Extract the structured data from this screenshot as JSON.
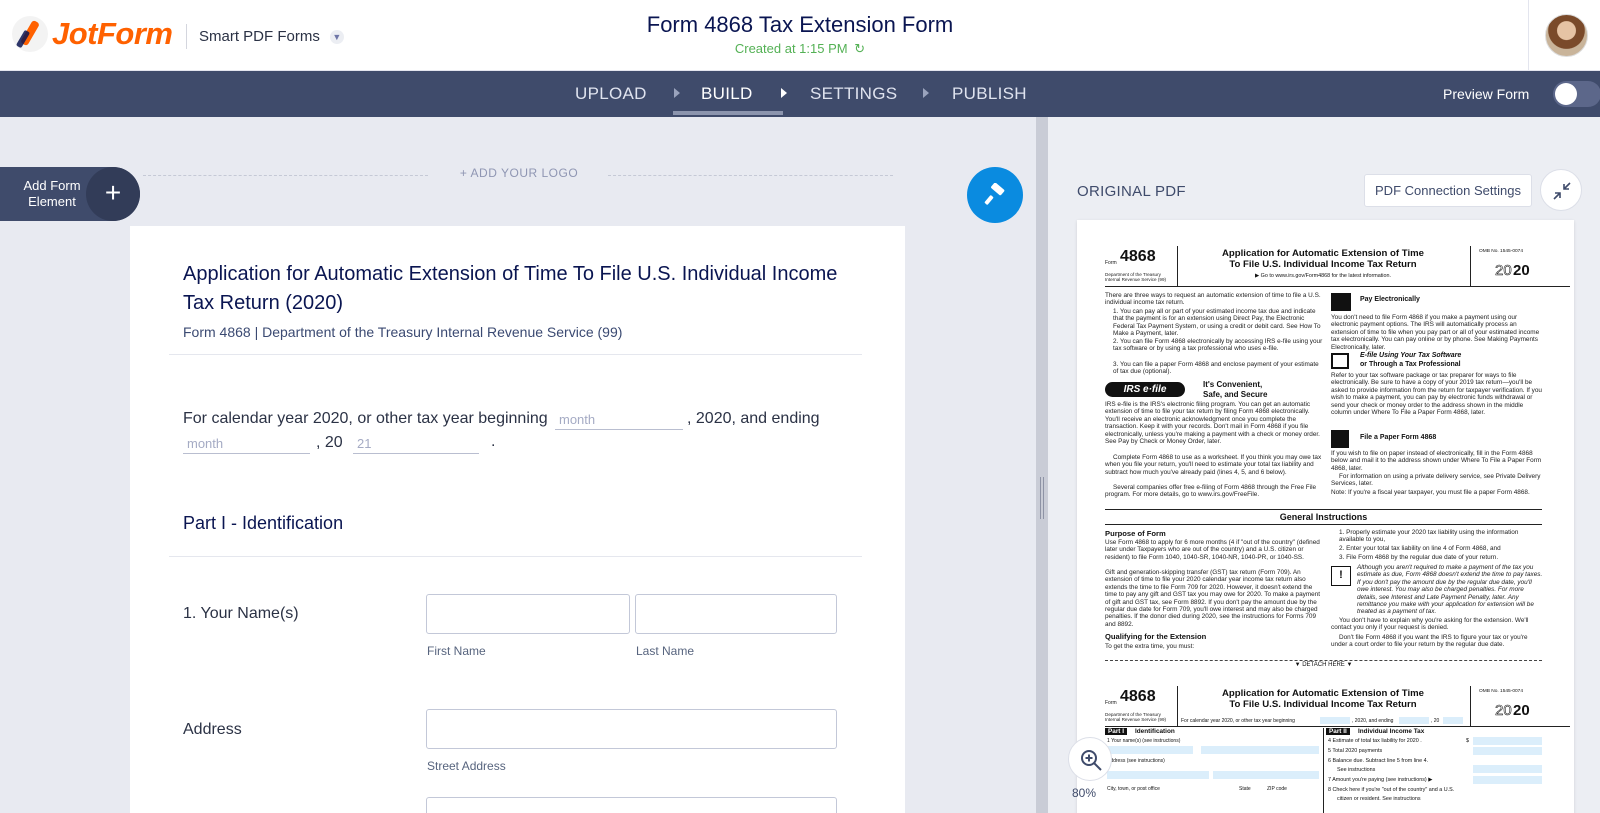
{
  "header": {
    "logo_text": "JotForm",
    "product": "Smart PDF Forms",
    "form_title": "Form 4868 Tax Extension Form",
    "created": "Created at 1:15 PM",
    "accent": "#ff6100"
  },
  "nav": {
    "steps": [
      "UPLOAD",
      "BUILD",
      "SETTINGS",
      "PUBLISH"
    ],
    "active": "BUILD",
    "preview_label": "Preview Form",
    "preview_on": false,
    "bar_color": "#3f4b6b"
  },
  "builder": {
    "add_element_label": "Add Form Element",
    "add_element_icon": "plus-icon",
    "add_logo": "+ ADD YOUR LOGO",
    "designer_icon": "paint-roller-icon",
    "designer_color": "#0a8be0"
  },
  "form": {
    "title": "Application for Automatic Extension of Time To File U.S. Individual Income Tax Return (2020)",
    "subtitle": "Form 4868 | Department of the Treasury Internal Revenue Service (99)",
    "calendar_text_1": "For calendar year 2020, or other tax year beginning",
    "calendar_field_1_placeholder": "month",
    "calendar_text_2": ", 2020, and ending",
    "calendar_field_2_placeholder": "month",
    "calendar_text_3": ", 20",
    "calendar_field_3_placeholder": "21",
    "calendar_text_4": ".",
    "part1_heading": "Part I - Identification",
    "name_label": "1. Your Name(s)",
    "first_name_sublabel": "First Name",
    "last_name_sublabel": "Last Name",
    "address_label": "Address",
    "street_sublabel": "Street Address"
  },
  "pdf_panel": {
    "title": "ORIGINAL PDF",
    "connection_button": "PDF Connection Settings",
    "collapse_icon": "collapse-arrows-icon",
    "zoom_icon": "zoom-in-icon",
    "zoom": "80%",
    "page": {
      "form_word": "Form",
      "form_number": "4868",
      "dept": "Department of the Treasury Internal Revenue Service (99)",
      "title_line_1": "Application for Automatic Extension of Time",
      "title_line_2": "To File U.S. Individual Income Tax Return",
      "goto": "▶ Go to www.irs.gov/Form4868 for the latest information.",
      "omb": "OMB No. 1545-0074",
      "year_outline": "20",
      "year_bold": "20",
      "intro": "There are three ways to request an automatic extension of time to file a U.S. individual income tax return.",
      "way_1": "1. You can pay all or part of your estimated income tax due and indicate that the payment is for an extension using Direct Pay, the Electronic Federal Tax Payment System, or using a credit or debit card. See How To Make a Payment, later.",
      "way_2": "2. You can file Form 4868 electronically by accessing IRS e-file using your tax software or by using a tax professional who uses e-file.",
      "way_3": "3. You can file a paper Form 4868 and enclose payment of your estimate of tax due (optional).",
      "efile_logo": "IRS e·file",
      "convenient_1": "It's Convenient,",
      "convenient_2": "Safe, and Secure",
      "efile_text": "IRS e-file is the IRS's electronic filing program. You can get an automatic extension of time to file your tax return by filing Form 4868 electronically. You'll receive an electronic acknowledgment once you complete the transaction. Keep it with your records. Don't mail in Form 4868 if you file electronically, unless you're making a payment with a check or money order. See Pay by Check or Money Order, later.",
      "worksheet": "Complete Form 4868 to use as a worksheet. If you think you may owe tax when you file your return, you'll need to estimate your total tax liability and subtract how much you've already paid (lines 4, 5, and 6 below).",
      "free_file": "Several companies offer free e-filing of Form 4868 through the Free File program. For more details, go to www.irs.gov/FreeFile.",
      "pay_elec": "Pay Electronically",
      "pay_elec_text": "You don't need to file Form 4868 if you make a payment using our electronic payment options. The IRS will automatically process an extension of time to file when you pay part or all of your estimated income tax electronically. You can pay online or by phone. See Making Payments Electronically, later.",
      "efile_using_1": "E-file Using Your Tax Software",
      "efile_using_2": "or Through a Tax Professional",
      "efile_using_text": "Refer to your tax software package or tax preparer for ways to file electronically. Be sure to have a copy of your 2019 tax return—you'll be asked to provide information from the return for taxpayer verification. If you wish to make a payment, you can pay by electronic funds withdrawal or send your check or money order to the address shown in the middle column under Where To File a Paper Form 4868, later.",
      "file_paper": "File a Paper Form 4868",
      "file_paper_text": "If you wish to file on paper instead of electronically, fill in the Form 4868 below and mail it to the address shown under Where To File a Paper Form 4868, later.",
      "private_delivery": "For information on using a private delivery service, see Private Delivery Services, later.",
      "note": "Note: If you're a fiscal year taxpayer, you must file a paper Form 4868.",
      "general": "General Instructions",
      "purpose": "Purpose of Form",
      "purpose_text": "Use Form 4868 to apply for 6 more months (4 if \"out of the country\" (defined later under Taxpayers who are out of the country) and a U.S. citizen or resident) to file Form 1040, 1040-SR, 1040-NR, 1040-PR, or 1040-SS.",
      "gst_text": "Gift and generation-skipping transfer (GST) tax return (Form 709). An extension of time to file your 2020 calendar year income tax return also extends the time to file Form 709 for 2020. However, it doesn't extend the time to pay any gift and GST tax you may owe for 2020. To make a payment of gift and GST tax, see Form 8892. If you don't pay the amount due by the regular due date for Form 709, you'll owe interest and may also be charged penalties. If the donor died during 2020, see the instructions for Forms 709 and 8892.",
      "qualifying": "Qualifying for the Extension",
      "qualifying_text": "To get the extra time, you must:",
      "step_1": "1. Properly estimate your 2020 tax liability using the information available to you,",
      "step_2": "2. Enter your total tax liability on line 4 of Form 4868, and",
      "step_3": "3. File Form 4868 by the regular due date of your return.",
      "caution_text": "Although you aren't required to make a payment of the tax you estimate as due, Form 4868 doesn't extend the time to pay taxes. If you don't pay the amount due by the regular due date, you'll owe interest. You may also be charged penalties. For more details, see Interest and Late Payment Penalty, later. Any remittance you make with your application for extension will be treated as a payment of tax.",
      "no_explain": "You don't have to explain why you're asking for the extension. We'll contact you only if your request is denied.",
      "dont_file": "Don't file Form 4868 if you want the IRS to figure your tax or you're under a court order to file your return by the regular due date.",
      "detach": "▼ DETACH HERE ▼",
      "form2_calendar": "For calendar year 2020, or other tax year beginning",
      "form2_ending": ", 2020, and ending",
      "form2_20": ", 20",
      "part1_tag": "Part I",
      "part1_title": "Identification",
      "part2_tag": "Part II",
      "part2_title": "Individual Income Tax",
      "line1": "1  Your name(s) (see instructions)",
      "line4": "4  Estimate of total tax liability for 2020 .",
      "dollar": "$",
      "line5": "5  Total 2020 payments",
      "line6a": "6  Balance due. Subtract line 5 from line 4.",
      "line6b": "See instructions",
      "line7": "7  Amount you're paying (see instructions) ▶",
      "line8a": "8  Check here if you're \"out of the country\" and a U.S.",
      "line8b": "citizen or resident. See instructions",
      "addr": "Address (see instructions)",
      "city": "City, town, or post office",
      "state": "State",
      "zip": "ZIP code"
    }
  }
}
